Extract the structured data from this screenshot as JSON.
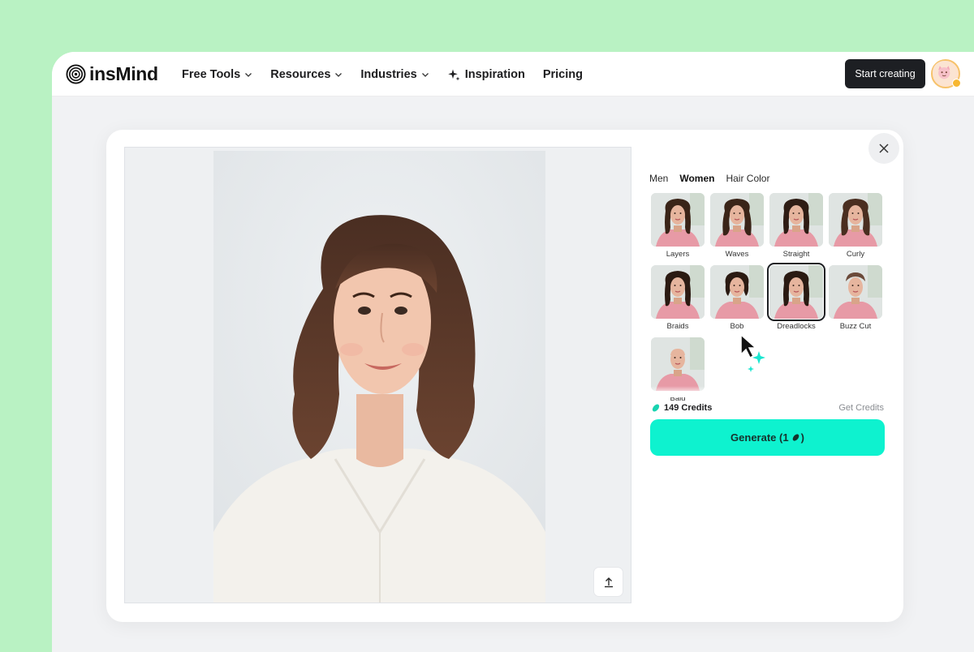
{
  "brand": {
    "name": "insMind"
  },
  "nav": {
    "items": [
      {
        "label": "Free Tools",
        "dropdown": true
      },
      {
        "label": "Resources",
        "dropdown": true
      },
      {
        "label": "Industries",
        "dropdown": true
      },
      {
        "label": "Inspiration",
        "icon": "sparkle-icon"
      },
      {
        "label": "Pricing"
      }
    ],
    "cta": "Start creating"
  },
  "editor": {
    "tabs": [
      "Men",
      "Women",
      "Hair Color"
    ],
    "active_tab": "Women",
    "styles": [
      {
        "label": "Layers",
        "selected": false
      },
      {
        "label": "Waves",
        "selected": false
      },
      {
        "label": "Straight",
        "selected": false
      },
      {
        "label": "Curly",
        "selected": false
      },
      {
        "label": "Braids",
        "selected": false
      },
      {
        "label": "Bob",
        "selected": false
      },
      {
        "label": "Dreadlocks",
        "selected": true
      },
      {
        "label": "Buzz Cut",
        "selected": false
      },
      {
        "label": "Bald",
        "selected": false
      }
    ],
    "credits_label": "149 Credits",
    "get_credits": "Get Credits",
    "generate": {
      "prefix": "Generate (1",
      "suffix": ")"
    }
  },
  "colors": {
    "page_background": "#b9f2c3",
    "accent": "#0ef2cf",
    "cta_dark": "#1d1f23"
  }
}
